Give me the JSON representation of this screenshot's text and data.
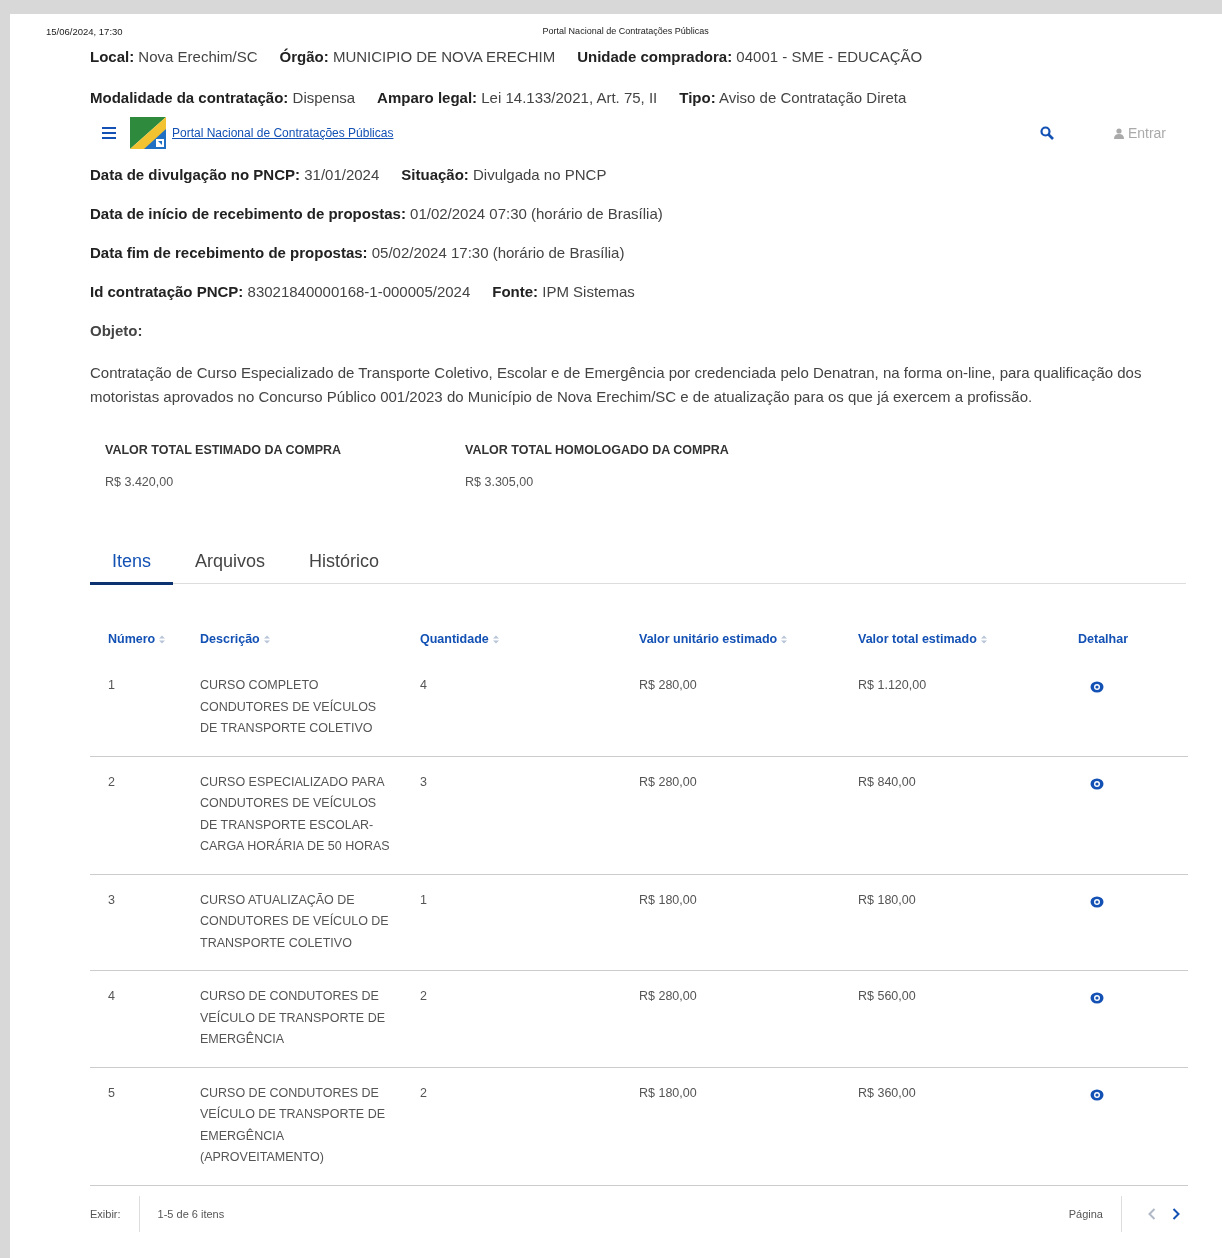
{
  "print_header": {
    "date": "15/06/2024, 17:30",
    "title": "Portal Nacional de Contratações Públicas"
  },
  "top_fields": [
    [
      {
        "label": "Local:",
        "value": "Nova Erechim/SC"
      },
      {
        "label": "Órgão:",
        "value": "MUNICIPIO DE NOVA ERECHIM"
      },
      {
        "label": "Unidade compradora:",
        "value": "04001 - SME - EDUCAÇÃO"
      }
    ],
    [
      {
        "label": "Modalidade da contratação:",
        "value": "Dispensa"
      },
      {
        "label": "Amparo legal:",
        "value": "Lei 14.133/2021, Art. 75, II"
      },
      {
        "label": "Tipo:",
        "value": "Aviso de Contratação Direta"
      }
    ]
  ],
  "navbar": {
    "portal_link": "Portal Nacional de Contratações Públicas",
    "login": "Entrar"
  },
  "fields": [
    [
      {
        "label": "Data de divulgação no PNCP:",
        "value": "31/01/2024"
      },
      {
        "label": "Situação:",
        "value": "Divulgada no PNCP"
      }
    ],
    [
      {
        "label": "Data de início de recebimento de propostas:",
        "value": "01/02/2024 07:30 (horário de Brasília)"
      }
    ],
    [
      {
        "label": "Data fim de recebimento de propostas:",
        "value": "05/02/2024 17:30 (horário de Brasília)"
      }
    ],
    [
      {
        "label": "Id contratação PNCP:",
        "value": "83021840000168-1-000005/2024"
      },
      {
        "label": "Fonte:",
        "value": "IPM Sistemas"
      }
    ]
  ],
  "objeto": {
    "label": "Objeto:",
    "text": "Contratação de Curso Especializado de Transporte Coletivo, Escolar e de Emergência por credenciada pelo Denatran, na forma on-line, para qualificação dos motoristas aprovados no Concurso Público 001/2023 do Município de Nova Erechim/SC e de atualização para os que já exercem a profissão."
  },
  "totals": [
    {
      "label": "VALOR TOTAL ESTIMADO DA COMPRA",
      "value": "R$ 3.420,00"
    },
    {
      "label": "VALOR TOTAL HOMOLOGADO DA COMPRA",
      "value": "R$ 3.305,00"
    }
  ],
  "tabs": [
    {
      "label": "Itens",
      "selected": true
    },
    {
      "label": "Arquivos",
      "selected": false
    },
    {
      "label": "Histórico",
      "selected": false
    }
  ],
  "table": {
    "columns": [
      {
        "label": "Número",
        "sortable": true
      },
      {
        "label": "Descrição",
        "sortable": true
      },
      {
        "label": "Quantidade",
        "sortable": true
      },
      {
        "label": "Valor unitário estimado",
        "sortable": true
      },
      {
        "label": "Valor total estimado",
        "sortable": true
      },
      {
        "label": "Detalhar",
        "sortable": false
      }
    ],
    "rows": [
      {
        "numero": "1",
        "descricao": "CURSO COMPLETO CONDUTORES DE VEÍCULOS DE TRANSPORTE COLETIVO",
        "quantidade": "4",
        "valor_unitario": "R$ 280,00",
        "valor_total": "R$ 1.120,00"
      },
      {
        "numero": "2",
        "descricao": "CURSO ESPECIALIZADO PARA CONDUTORES DE VEÍCULOS DE TRANSPORTE ESCOLAR- CARGA HORÁRIA DE 50 HORAS",
        "quantidade": "3",
        "valor_unitario": "R$ 280,00",
        "valor_total": "R$ 840,00"
      },
      {
        "numero": "3",
        "descricao": "CURSO ATUALIZAÇÃO DE CONDUTORES DE VEÍCULO DE TRANSPORTE COLETIVO",
        "quantidade": "1",
        "valor_unitario": "R$ 180,00",
        "valor_total": "R$ 180,00"
      },
      {
        "numero": "4",
        "descricao": "CURSO DE CONDUTORES DE VEÍCULO DE TRANSPORTE DE EMERGÊNCIA",
        "quantidade": "2",
        "valor_unitario": "R$ 280,00",
        "valor_total": "R$ 560,00"
      },
      {
        "numero": "5",
        "descricao": "CURSO DE CONDUTORES DE VEÍCULO DE TRANSPORTE DE EMERGÊNCIA (APROVEITAMENTO)",
        "quantidade": "2",
        "valor_unitario": "R$ 180,00",
        "valor_total": "R$ 360,00"
      }
    ]
  },
  "pagination": {
    "show_label": "Exibir:",
    "range": "1-5 de 6 itens",
    "page_label": "Página",
    "prev_disabled": true,
    "next_disabled": false
  }
}
